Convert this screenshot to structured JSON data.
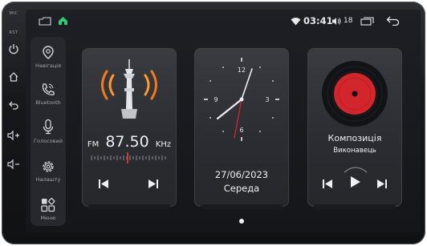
{
  "hardware": {
    "mic_label": "MIC",
    "rst_label": "RST"
  },
  "status_bar": {
    "time": "03:41",
    "volume": "18"
  },
  "sidebar": {
    "items": [
      {
        "label": "Навігація",
        "icon": "navigation-pin-icon"
      },
      {
        "label": "Bluetooth",
        "icon": "phone-icon"
      },
      {
        "label": "Голосовий",
        "icon": "microphone-icon"
      },
      {
        "label": "Налашту",
        "icon": "gear-icon"
      },
      {
        "label": "Меню",
        "icon": "apps-grid-icon"
      }
    ]
  },
  "radio_card": {
    "band": "FM",
    "frequency": "87.50",
    "unit": "KHz"
  },
  "clock_card": {
    "dial_numbers": [
      "12",
      "3",
      "6",
      "9"
    ],
    "date": "27/06/2023",
    "weekday": "Середа"
  },
  "music_card": {
    "title": "Композиція",
    "artist": "Виконавець"
  },
  "colors": {
    "accent_red": "#d3262c",
    "card_bg": "#34363b"
  }
}
